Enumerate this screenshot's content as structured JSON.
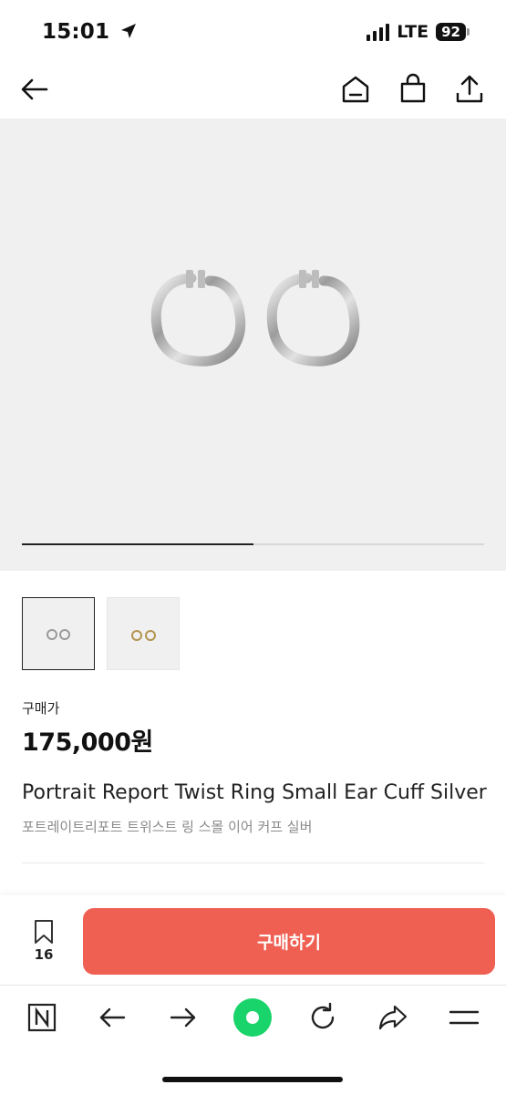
{
  "status_bar": {
    "time": "15:01",
    "network": "LTE",
    "battery": "92"
  },
  "top_nav": {
    "icons": [
      "back-arrow-icon",
      "home-icon",
      "shopping-bag-icon",
      "share-icon"
    ]
  },
  "gallery": {
    "progress": 0.5,
    "thumbnails": [
      {
        "variant": "silver",
        "selected": true
      },
      {
        "variant": "gold",
        "selected": false
      }
    ]
  },
  "product": {
    "price_label": "구매가",
    "price": "175,000원",
    "name_en": "Portrait Report Twist Ring Small Ear Cuff Silver",
    "name_ko": "포트레이트리포트 트위스트 링 스몰 이어 커프 실버"
  },
  "purchase_bar": {
    "wish_count": "16",
    "buy_label": "구매하기",
    "accent_color": "#ef5f52"
  },
  "browser_bar": {
    "icons": [
      "naver-icon",
      "back-icon",
      "forward-icon",
      "green-dot-icon",
      "reload-icon",
      "share-icon",
      "menu-icon"
    ]
  }
}
